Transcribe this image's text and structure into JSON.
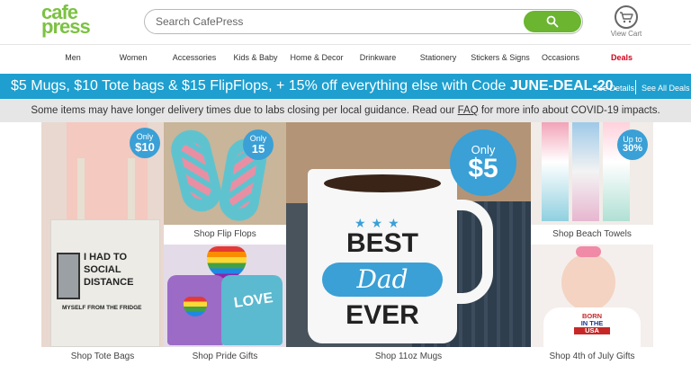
{
  "logo": {
    "line1": "cafe",
    "line2": "press"
  },
  "search": {
    "placeholder": "Search CafePress"
  },
  "cart": {
    "label": "View Cart"
  },
  "nav": [
    "Men",
    "Women",
    "Accessories",
    "Kids & Baby",
    "Home & Decor",
    "Drinkware",
    "Stationery",
    "Stickers & Signs",
    "Occasions",
    "Deals"
  ],
  "promo": {
    "text": "$5 Mugs, $10 Tote bags & $15 FlipFlops, + 15% off everything else with Code ",
    "code": "JUNE-DEAL-20.",
    "see_details": "See Details",
    "see_all_deals": "See All Deals"
  },
  "notice": {
    "before": "Some items may have longer delivery times due to labs closing per local guidance. Read our ",
    "link": "FAQ",
    "after": " for more info about COVID-19 impacts."
  },
  "tiles": {
    "tote": {
      "caption": "Shop Tote Bags",
      "badge_top": "Only",
      "badge_value": "$10",
      "print": [
        "I HAD TO",
        "SOCIAL",
        "DISTANCE",
        "MYSELF FROM THE FRIDGE"
      ]
    },
    "flipflops": {
      "caption": "Shop Flip Flops",
      "badge_top": "Only",
      "badge_value": "15"
    },
    "pride": {
      "caption": "Shop Pride Gifts",
      "print": "LOVE"
    },
    "mugs": {
      "caption": "Shop 11oz Mugs",
      "badge_top": "Only",
      "badge_value": "$5",
      "print": [
        "BEST",
        "Dad",
        "EVER"
      ]
    },
    "towels": {
      "caption": "Shop Beach Towels",
      "badge_top": "Up to",
      "badge_value": "30%"
    },
    "july": {
      "caption": "Shop 4th of July Gifts",
      "print": [
        "BORN",
        "IN THE",
        "USA"
      ]
    }
  },
  "colors": {
    "brand_green": "#7cc242",
    "promo_blue": "#1e9fcf",
    "badge_blue": "#3aa0d6",
    "deals_red": "#d0021b"
  }
}
